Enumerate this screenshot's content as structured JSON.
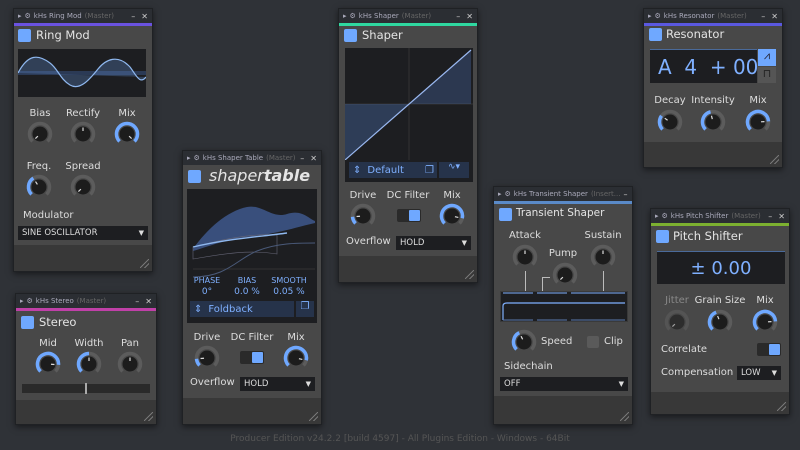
{
  "status_bar": "Producer Edition v24.2.2 [build 4597] - All Plugins Edition - Windows - 64Bit",
  "colors": {
    "accent_blue": "#6fa8ff",
    "ring_mod": "#6a52e0",
    "stereo": "#c040a8",
    "shaper": "#2fd8a0",
    "transient": "#5a8ac8",
    "resonator": "#5a58e0",
    "pitch": "#7cb030"
  },
  "ring_mod": {
    "window_title": "kHs Ring Mod",
    "window_sub": "(Master)",
    "title": "Ring Mod",
    "knobs": {
      "bias": {
        "label": "Bias",
        "value": 0
      },
      "rectify": {
        "label": "Rectify",
        "value": 0.5,
        "mode": "bi"
      },
      "mix": {
        "label": "Mix",
        "value": 1
      },
      "freq": {
        "label": "Freq.",
        "value": 0.38
      },
      "spread": {
        "label": "Spread",
        "value": 0
      }
    },
    "modulator_label": "Modulator",
    "modulator_value": "SINE OSCILLATOR"
  },
  "stereo": {
    "window_title": "kHs Stereo",
    "window_sub": "(Master)",
    "title": "Stereo",
    "knobs": {
      "mid": {
        "label": "Mid",
        "value": 0.85
      },
      "width": {
        "label": "Width",
        "value": 0.5
      },
      "pan": {
        "label": "Pan",
        "value": 0.5,
        "mode": "bi"
      }
    }
  },
  "shaper_table": {
    "window_title": "kHs Shaper Table",
    "window_sub": "(Master)",
    "title_light": "shaper",
    "title_bold": "table",
    "params": [
      {
        "label": "PHASE",
        "value": "0°"
      },
      {
        "label": "BIAS",
        "value": "0.0 %"
      },
      {
        "label": "SMOOTH",
        "value": "0.05 %"
      }
    ],
    "preset": "Foldback",
    "knobs": {
      "drive": {
        "label": "Drive",
        "value": 0.15
      },
      "mix": {
        "label": "Mix",
        "value": 0.88
      }
    },
    "dc_filter_label": "DC Filter",
    "dc_filter_on": true,
    "overflow_label": "Overflow",
    "overflow_value": "HOLD"
  },
  "shaper": {
    "window_title": "kHs Shaper",
    "window_sub": "(Master)",
    "title": "Shaper",
    "preset": "Default",
    "knobs": {
      "drive": {
        "label": "Drive",
        "value": 0.15
      },
      "mix": {
        "label": "Mix",
        "value": 0.88
      }
    },
    "dc_filter_label": "DC Filter",
    "dc_filter_on": true,
    "overflow_label": "Overflow",
    "overflow_value": "HOLD"
  },
  "transient": {
    "window_title": "kHs Transient Shaper",
    "window_sub": "(Insert...",
    "title": "Transient Shaper",
    "knobs": {
      "attack": {
        "label": "Attack",
        "value": 0.5,
        "mode": "bi"
      },
      "pump": {
        "label": "Pump",
        "value": 0
      },
      "sustain": {
        "label": "Sustain",
        "value": 0.5,
        "mode": "bi"
      },
      "speed": {
        "label": "Speed",
        "value": 0.4
      }
    },
    "clip_label": "Clip",
    "clip_on": false,
    "sidechain_label": "Sidechain",
    "sidechain_value": "OFF"
  },
  "resonator": {
    "window_title": "kHs Resonator",
    "window_sub": "(Master)",
    "title": "Resonator",
    "note": "A  4  + 00",
    "knobs": {
      "decay": {
        "label": "Decay",
        "value": 0.3
      },
      "intensity": {
        "label": "Intensity",
        "value": 0.45
      },
      "mix": {
        "label": "Mix",
        "value": 0.82
      }
    }
  },
  "pitch": {
    "window_title": "kHs Pitch Shifter",
    "window_sub": "(Master)",
    "title": "Pitch Shifter",
    "pitch_value": "± 0.00",
    "knobs": {
      "jitter": {
        "label": "Jitter",
        "value": 0
      },
      "grain": {
        "label": "Grain Size",
        "value": 0.42
      },
      "mix": {
        "label": "Mix",
        "value": 0.82
      }
    },
    "correlate_label": "Correlate",
    "correlate_on": true,
    "compensation_label": "Compensation",
    "compensation_value": "LOW"
  }
}
